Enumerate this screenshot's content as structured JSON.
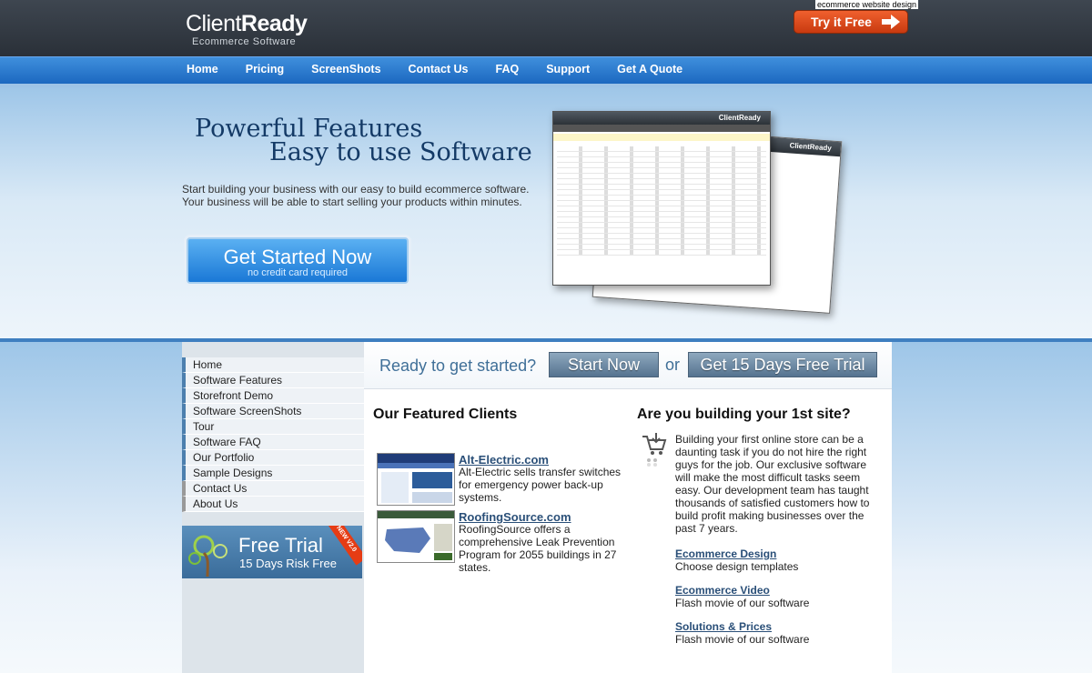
{
  "header": {
    "logo_light": "Client",
    "logo_bold": "Ready",
    "logo_sub": "Ecommerce  Software",
    "tagline": "ecommerce website design",
    "try_free": "Try it Free"
  },
  "nav": {
    "items": [
      "Home",
      "Pricing",
      "ScreenShots",
      "Contact Us",
      "FAQ",
      "Support",
      "Get A Quote"
    ]
  },
  "hero": {
    "title1": "Powerful Features",
    "title2": "Easy to use Software",
    "desc1": "Start building your business with our easy to build ecommerce software.",
    "desc2": "Your business will be able to start selling your products within minutes.",
    "cta_big": "Get Started Now",
    "cta_small": "no credit card required",
    "shot_brand": "ClientReady"
  },
  "sidebar": {
    "items": [
      "Home",
      "Software Features",
      "Storefront Demo",
      "Software ScreenShots",
      "Tour",
      "Software FAQ",
      "Our Portfolio",
      "Sample Designs",
      "Contact Us",
      "About Us"
    ],
    "free_trial_title": "Free Trial",
    "free_trial_sub": "15 Days Risk Free",
    "ribbon": "NEW V2.0"
  },
  "ready": {
    "text": "Ready to get started?",
    "start_now": "Start Now",
    "or": "or",
    "free_trial": "Get 15 Days Free Trial"
  },
  "clients": {
    "title": "Our Featured Clients",
    "items": [
      {
        "name": "Alt-Electric.com",
        "desc": "Alt-Electric sells transfer switches for emergency power back-up systems."
      },
      {
        "name": "RoofingSource.com",
        "desc": "RoofingSource offers a comprehensive Leak Prevention Program for 2055 buildings in 27 states."
      }
    ]
  },
  "build": {
    "title": "Are you building your 1st site?",
    "text": "Building your first online store can be a daunting task if you do not hire the right guys for the job. Our exclusive software will make the most difficult tasks seem easy. Our development team has taught thousands of satisfied customers how to build profit making businesses over the past 7 years.",
    "links": [
      {
        "title": "Ecommerce Design",
        "desc": "Choose design templates"
      },
      {
        "title": "Ecommerce Video",
        "desc": "Flash movie of our software"
      },
      {
        "title": "Solutions & Prices",
        "desc": "Flash movie of our software"
      }
    ]
  }
}
